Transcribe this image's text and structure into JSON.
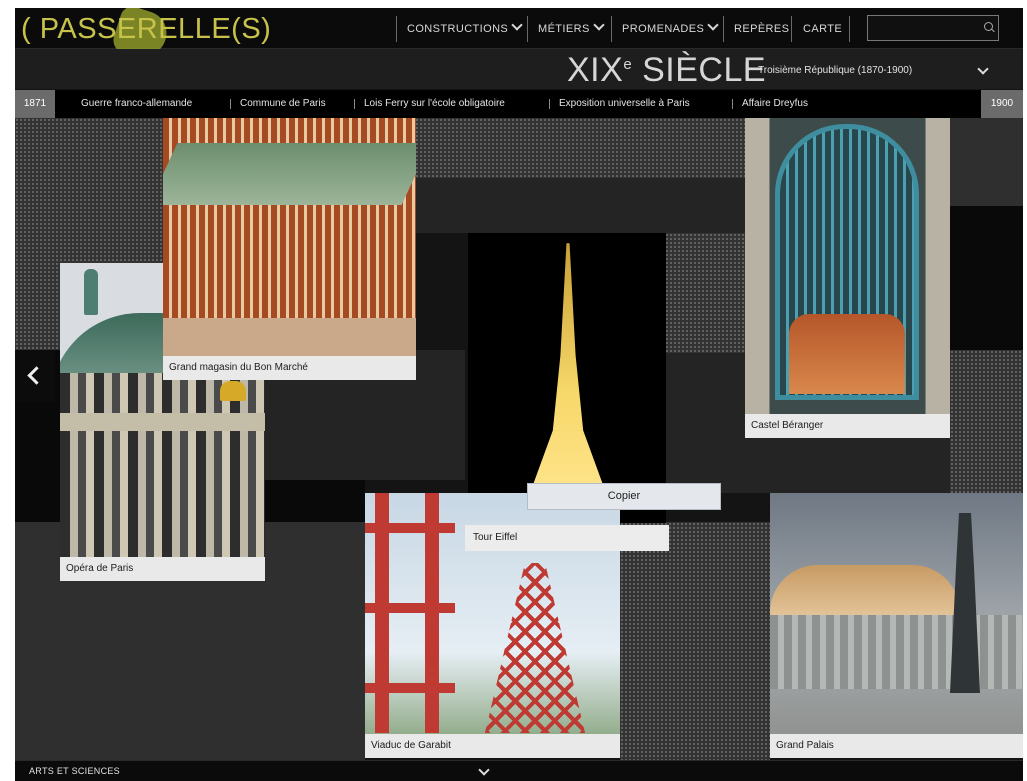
{
  "brand": {
    "logo": "( PASSERELLE(S)"
  },
  "nav": {
    "items": [
      {
        "label": "CONSTRUCTIONS",
        "has_menu": true
      },
      {
        "label": "MÉTIERS",
        "has_menu": true
      },
      {
        "label": "PROMENADES",
        "has_menu": true
      },
      {
        "label": "REPÈRES",
        "has_menu": false
      },
      {
        "label": "CARTE",
        "has_menu": false
      }
    ],
    "search_placeholder": ""
  },
  "header": {
    "century": "XIX",
    "century_suffix": "e",
    "century_word": "SIÈCLE",
    "period": "Troisième République (1870-1900)"
  },
  "timeline": {
    "start_year": "1871",
    "end_year": "1900",
    "events": [
      "Guerre franco-allemande",
      "Commune de Paris",
      "Lois Ferry sur l'école obligatoire",
      "Exposition universelle à Paris",
      "Affaire Dreyfus"
    ]
  },
  "cards": {
    "bon_marche": "Grand magasin du Bon Marché",
    "opera": "Opéra de Paris",
    "eiffel": "Tour Eiffel",
    "castel": "Castel Béranger",
    "garabit": "Viaduc de Garabit",
    "grand_palais": "Grand Palais"
  },
  "context_menu": {
    "item": "Copier"
  },
  "footer": {
    "label": "ARTS ET SCIENCES"
  },
  "colors": {
    "logo": "#c6c24a",
    "caption_bg": "#e9e9e9",
    "background": "#141414"
  },
  "icons": {
    "prev": "chevron-left-icon",
    "search": "search-icon",
    "footer": "chevron-down-icon"
  }
}
